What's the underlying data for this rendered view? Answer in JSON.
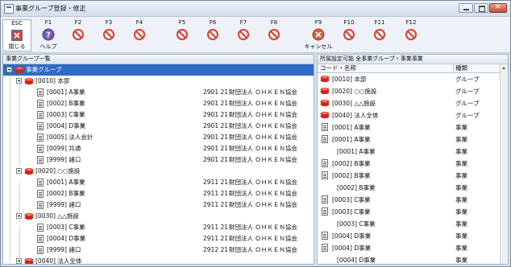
{
  "window": {
    "title": "事業グループ登録・修正"
  },
  "toolbar": {
    "esc": {
      "key": "ESC",
      "label": "閉じる",
      "icon": "close-doc-icon"
    },
    "fkeys": [
      {
        "key": "F1",
        "label": "ヘルプ",
        "icon": "help-icon"
      },
      {
        "key": "F2",
        "label": "",
        "icon": "disabled-icon"
      },
      {
        "key": "F3",
        "label": "",
        "icon": "disabled-icon"
      },
      {
        "key": "F4",
        "label": "",
        "icon": "disabled-icon"
      },
      {
        "key": "F5",
        "label": "",
        "icon": "disabled-icon"
      },
      {
        "key": "F6",
        "label": "",
        "icon": "disabled-icon"
      },
      {
        "key": "F7",
        "label": "",
        "icon": "disabled-icon"
      },
      {
        "key": "F8",
        "label": "",
        "icon": "disabled-icon"
      },
      {
        "key": "F9",
        "label": "キャンセル",
        "icon": "cancel-icon"
      },
      {
        "key": "F10",
        "label": "",
        "icon": "disabled-icon"
      },
      {
        "key": "F11",
        "label": "",
        "icon": "disabled-icon"
      },
      {
        "key": "F12",
        "label": "",
        "icon": "disabled-icon"
      }
    ]
  },
  "left_panel": {
    "header": "事業グループ一覧",
    "rows": [
      {
        "text": "事業グループ",
        "selected": true,
        "num": "",
        "corp": ""
      },
      {
        "text": "[0010] 本部",
        "num": "",
        "corp": ""
      },
      {
        "text": "[0001] A事業",
        "num": "2901 21",
        "corp": "財団法人 ＯＨＫＥＮ協会"
      },
      {
        "text": "[0002] B事業",
        "num": "2901 21",
        "corp": "財団法人 ＯＨＫＥＮ協会"
      },
      {
        "text": "[0003] C事業",
        "num": "2901 21",
        "corp": "財団法人 ＯＨＫＥＮ協会"
      },
      {
        "text": "[0004] D事業",
        "num": "2901 21",
        "corp": "財団法人 ＯＨＫＥＮ協会"
      },
      {
        "text": "[0005] 法人会計",
        "num": "2901 21",
        "corp": "財団法人 ＯＨＫＥＮ協会"
      },
      {
        "text": "[0099] 共通",
        "num": "2901 21",
        "corp": "財団法人 ＯＨＫＥＮ協会"
      },
      {
        "text": "[9999] 諸口",
        "num": "2901 21",
        "corp": "財団法人 ＯＨＫＥＮ協会"
      },
      {
        "text": "[0020] ○○施設",
        "num": "",
        "corp": ""
      },
      {
        "text": "[0001] A事業",
        "num": "2911 21",
        "corp": "財団法人 ＯＨＫＥＮ協会"
      },
      {
        "text": "[0002] B事業",
        "num": "2911 21",
        "corp": "財団法人 ＯＨＫＥＮ協会"
      },
      {
        "text": "[9999] 諸口",
        "num": "2911 21",
        "corp": "財団法人 ＯＨＫＥＮ協会"
      },
      {
        "text": "[0030] △△施設",
        "num": "",
        "corp": ""
      },
      {
        "text": "[0003] C事業",
        "num": "2911 21",
        "corp": "財団法人 ＯＨＫＥＮ協会"
      },
      {
        "text": "[0004] D事業",
        "num": "2911 21",
        "corp": "財団法人 ＯＨＫＥＮ協会"
      },
      {
        "text": "[9999] 諸口",
        "num": "2912 21",
        "corp": "財団法人 ＯＨＫＥＮ協会"
      },
      {
        "text": "[0040] 法人全体",
        "num": "",
        "corp": ""
      }
    ]
  },
  "right_panel": {
    "header": "所属設定可能 全事業グループ・事業事業",
    "col_code": "コード・名称",
    "col_kind": "種類",
    "rows": [
      {
        "name": "[0010] 本部",
        "kind": "グループ"
      },
      {
        "name": "[0020] ○○施設",
        "kind": "グループ"
      },
      {
        "name": "[0030] △△施設",
        "kind": "グループ"
      },
      {
        "name": "[0040] 法人全体",
        "kind": "グループ"
      },
      {
        "name": "[0001] A事業",
        "kind": "事業"
      },
      {
        "name": "[0001] A事業",
        "kind": "事業"
      },
      {
        "name": "[0001] A事業",
        "kind": "事業"
      },
      {
        "name": "[0002] B事業",
        "kind": "事業"
      },
      {
        "name": "[0002] B事業",
        "kind": "事業"
      },
      {
        "name": "[0002] B事業",
        "kind": "事業"
      },
      {
        "name": "[0003] C事業",
        "kind": "事業"
      },
      {
        "name": "[0003] C事業",
        "kind": "事業"
      },
      {
        "name": "[0003] C事業",
        "kind": "事業"
      },
      {
        "name": "[0004] D事業",
        "kind": "事業"
      },
      {
        "name": "[0004] D事業",
        "kind": "事業"
      },
      {
        "name": "[0004] D事業",
        "kind": "事業"
      }
    ]
  },
  "colors": {
    "selection": "#316ac5",
    "disabled_red": "#d9402a",
    "help_purple": "#7a5bb5"
  }
}
